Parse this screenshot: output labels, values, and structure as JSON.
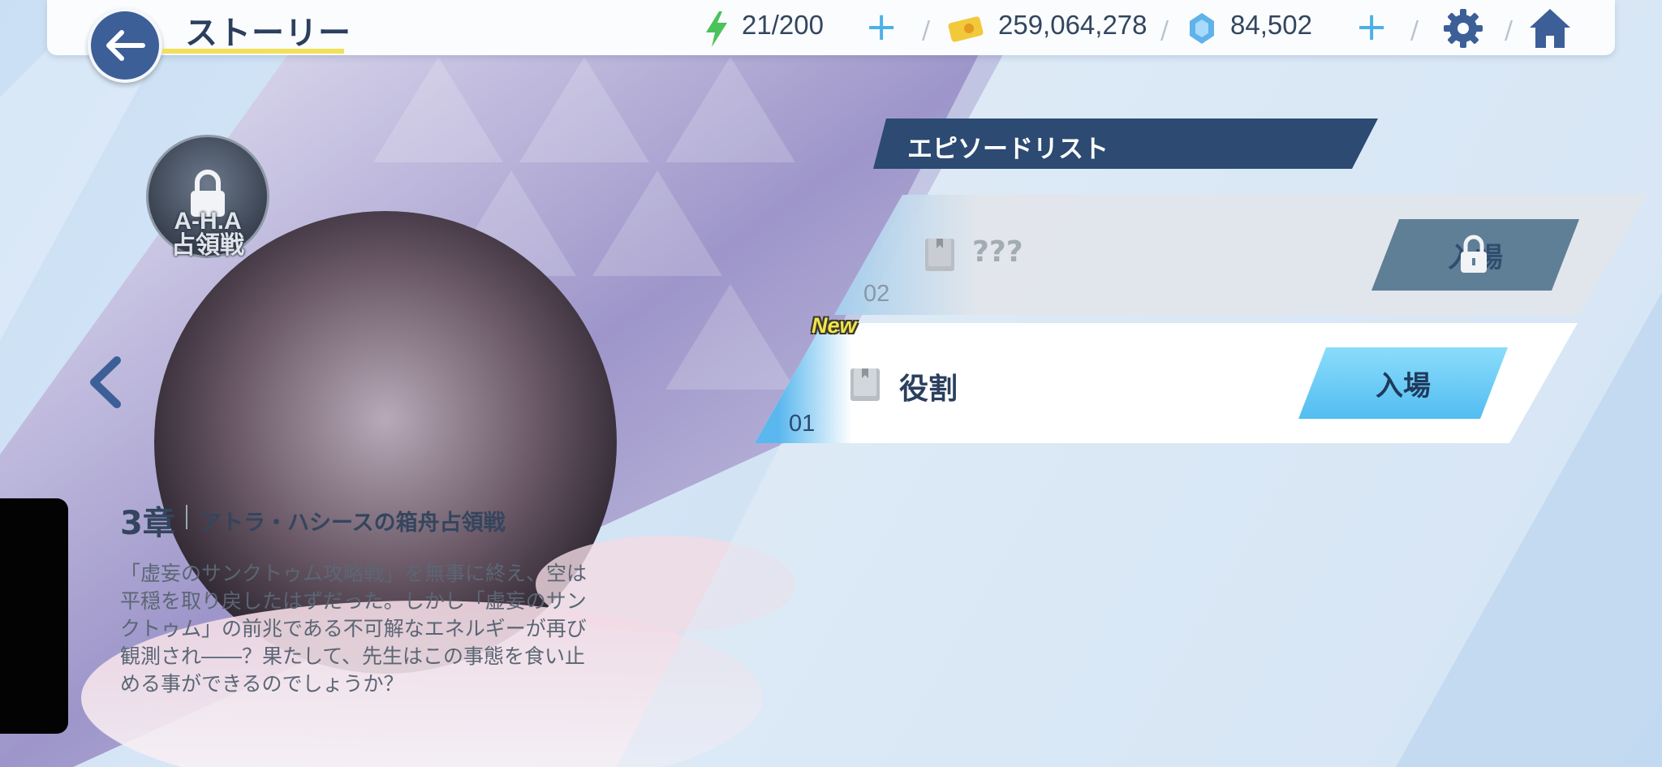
{
  "header": {
    "title": "ストーリー",
    "ap": "21/200",
    "credits": "259,064,278",
    "gems": "84,502"
  },
  "chapter": {
    "emblem_text_line1": "A-H.A",
    "emblem_text_line2": "占領戦",
    "label": "3章",
    "title": "アトラ・ハシースの箱舟占領戦",
    "description": "「虚妄のサンクトゥム攻略戦」を無事に終え、空は平穏を取り戻したはずだった。しかし「虚妄のサンクトゥム」の前兆である不可解なエネルギーが再び観測され――？果たして、先生はこの事態を食い止める事ができるのでしょうか？"
  },
  "episode_list": {
    "header": "エピソードリスト",
    "episodes": [
      {
        "number": "02",
        "name": "???",
        "button": "入場",
        "locked": true
      },
      {
        "number": "01",
        "name": "役割",
        "button": "入場",
        "locked": false,
        "badge": "New"
      }
    ]
  },
  "colors": {
    "accent_blue": "#52bdf1",
    "header_navy": "#2c4a72",
    "title_underline": "#f2e05a"
  }
}
